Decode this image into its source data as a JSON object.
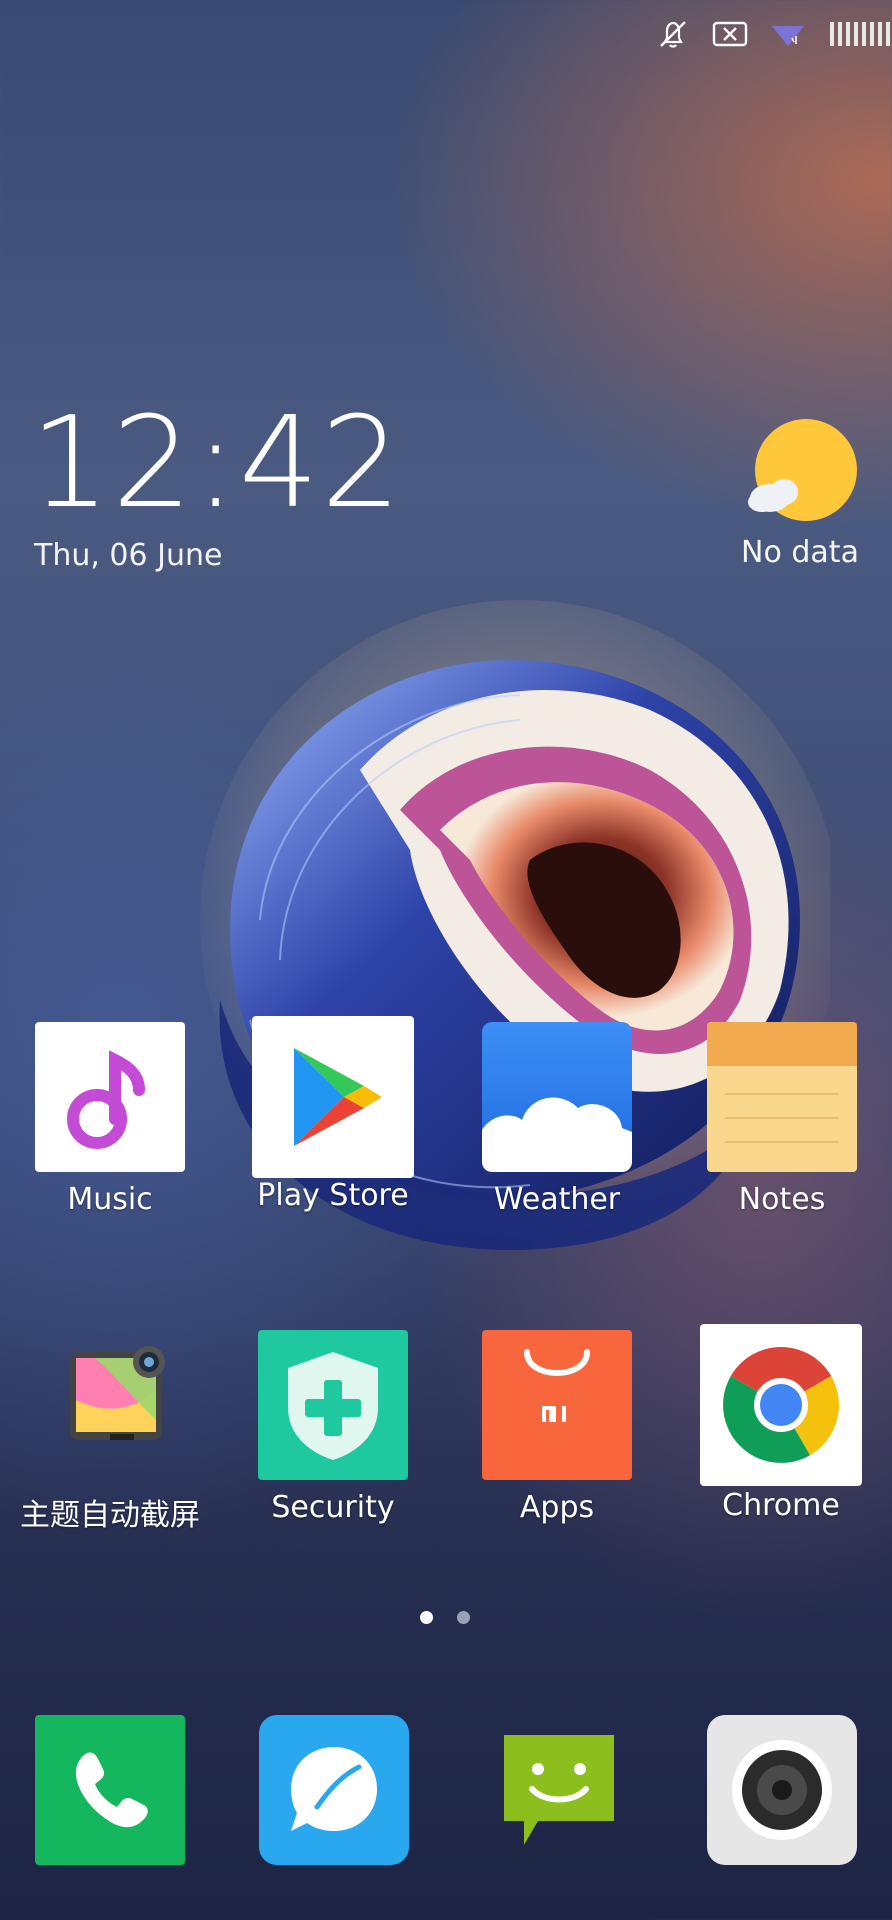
{
  "status_bar": {
    "icons": [
      "notifications-off-icon",
      "sim-x-icon",
      "wifi-icon",
      "signal-icon"
    ]
  },
  "clock_widget": {
    "time": "12:42",
    "date": "Thu, 06 June"
  },
  "weather_widget": {
    "status": "No data",
    "icon": "partly-sunny-icon"
  },
  "home_apps": [
    {
      "label": "Music",
      "icon": "music-note-icon"
    },
    {
      "label": "Play Store",
      "icon": "play-store-icon"
    },
    {
      "label": "Weather",
      "icon": "cloud-icon"
    },
    {
      "label": "Notes",
      "icon": "notepad-icon"
    },
    {
      "label": "主题自动截屏",
      "icon": "theme-screenshot-icon"
    },
    {
      "label": "Security",
      "icon": "shield-plus-icon"
    },
    {
      "label": "Apps",
      "icon": "mi-bag-icon"
    },
    {
      "label": "Chrome",
      "icon": "chrome-icon"
    }
  ],
  "page_indicator": {
    "pages": 2,
    "current": 1
  },
  "dock": [
    {
      "name": "phone",
      "icon": "phone-icon"
    },
    {
      "name": "browser",
      "icon": "browser-bubble-icon"
    },
    {
      "name": "messages",
      "icon": "message-smile-icon"
    },
    {
      "name": "camera",
      "icon": "camera-lens-icon"
    }
  ],
  "colors": {
    "music_accent": "#c34bd6",
    "weather_blue": "#2f86f0",
    "notes_yellow": "#f9d88d",
    "security_teal": "#1ec99f",
    "apps_orange": "#f7663d",
    "phone_green": "#15b75e",
    "browser_blue": "#2aa8ef",
    "messages_green": "#8cbf1e"
  }
}
